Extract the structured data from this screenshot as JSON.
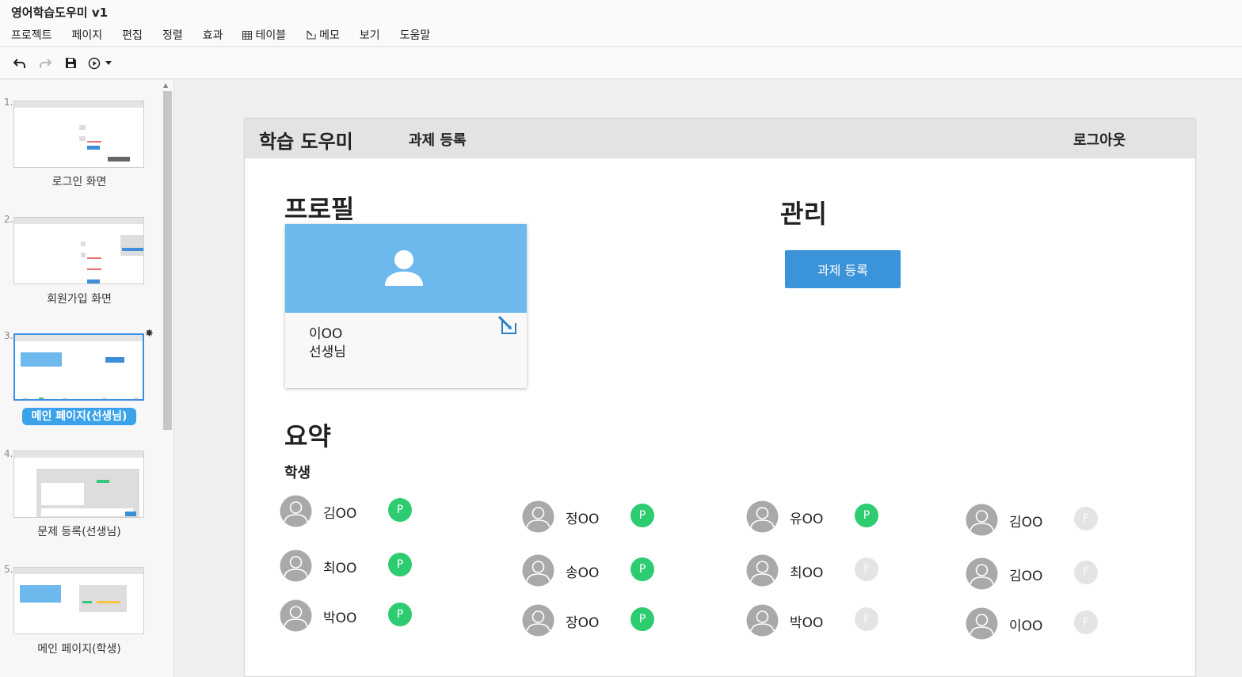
{
  "app": {
    "title": "영어학습도우미 v1"
  },
  "menu": {
    "items": [
      "프로젝트",
      "페이지",
      "편집",
      "정렬",
      "효과",
      "테이블",
      "메모",
      "보기",
      "도움말"
    ]
  },
  "toolbar": {
    "icons": [
      "undo-icon",
      "redo-icon",
      "save-icon",
      "play-icon"
    ]
  },
  "slides": [
    {
      "num": "1.",
      "label": "로그인 화면"
    },
    {
      "num": "2.",
      "label": "회원가입 화면"
    },
    {
      "num": "3.",
      "label": "메인 페이지(선생님)",
      "active": true
    },
    {
      "num": "4.",
      "label": "문제 등록(선생님)"
    },
    {
      "num": "5.",
      "label": "메인 페이지(학생)"
    }
  ],
  "page": {
    "header": {
      "brand": "학습 도우미",
      "nav": "과제 등록",
      "logout": "로그아웃"
    },
    "profile": {
      "heading": "프로필",
      "name": "이OO",
      "role": "선생님"
    },
    "manage": {
      "heading": "관리",
      "button": "과제 등록"
    },
    "summary": {
      "heading": "요약",
      "subheading": "학생",
      "students": [
        {
          "name": "김OO",
          "status": "P"
        },
        {
          "name": "정OO",
          "status": "P"
        },
        {
          "name": "유OO",
          "status": "P"
        },
        {
          "name": "김OO",
          "status": "F"
        },
        {
          "name": "최OO",
          "status": "P"
        },
        {
          "name": "송OO",
          "status": "P"
        },
        {
          "name": "최OO",
          "status": "F"
        },
        {
          "name": "김OO",
          "status": "F"
        },
        {
          "name": "박OO",
          "status": "P"
        },
        {
          "name": "장OO",
          "status": "P"
        },
        {
          "name": "박OO",
          "status": "F"
        },
        {
          "name": "이OO",
          "status": "F"
        }
      ]
    }
  },
  "colors": {
    "accent": "#3b93d9",
    "profile_bg": "#6db9ee",
    "pass": "#2ecc71",
    "fail": "#e4e4e4",
    "slide_label_active": "#3ba3ea"
  }
}
